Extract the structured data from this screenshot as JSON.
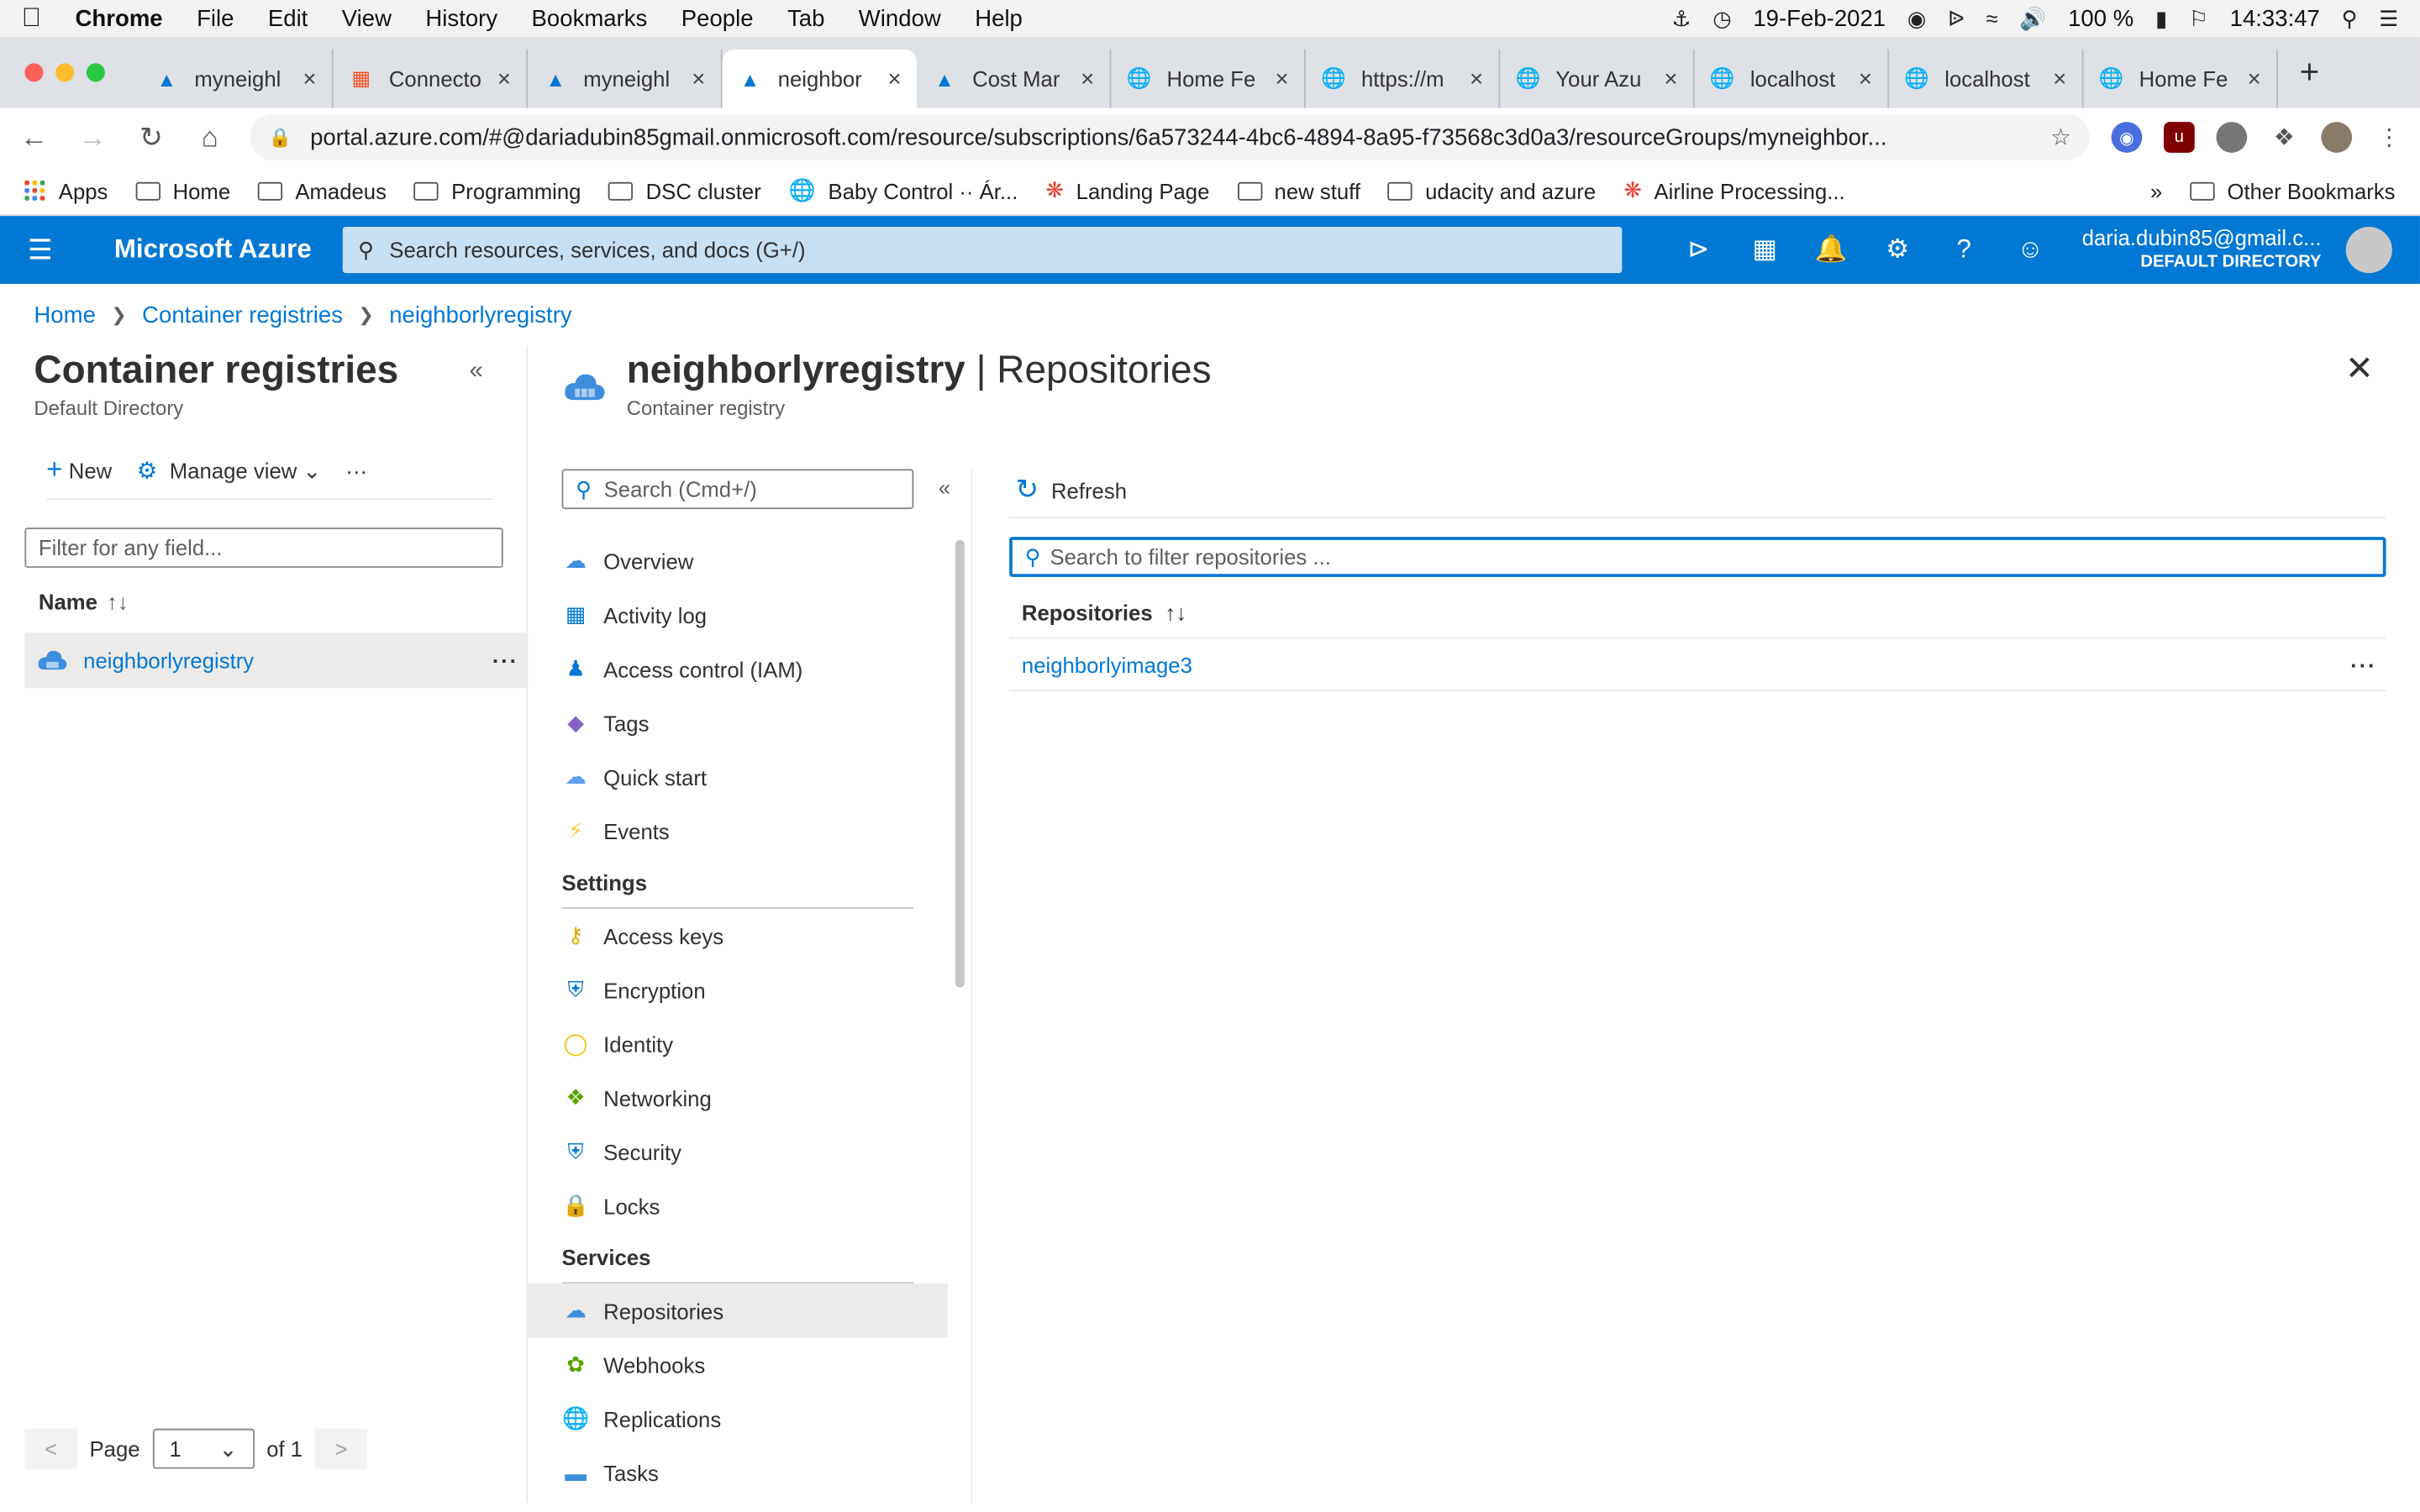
{
  "macos": {
    "app_name": "Chrome",
    "menus": [
      "File",
      "Edit",
      "View",
      "History",
      "Bookmarks",
      "People",
      "Tab",
      "Window",
      "Help"
    ],
    "date": "19-Feb-2021",
    "battery": "100 %",
    "time": "14:33:47"
  },
  "browser": {
    "tabs": [
      {
        "label": "myneighl",
        "icon": "azure-icon",
        "active": false
      },
      {
        "label": "Connecto",
        "icon": "microsoft-icon",
        "active": false
      },
      {
        "label": "myneighl",
        "icon": "azure-icon",
        "active": false
      },
      {
        "label": "neighbor",
        "icon": "azure-icon",
        "active": true
      },
      {
        "label": "Cost Mar",
        "icon": "azure-icon",
        "active": false
      },
      {
        "label": "Home Fe",
        "icon": "globe-icon",
        "active": false
      },
      {
        "label": "https://m",
        "icon": "globe-icon",
        "active": false
      },
      {
        "label": "Your Azu",
        "icon": "globe-icon",
        "active": false
      },
      {
        "label": "localhost",
        "icon": "globe-icon",
        "active": false
      },
      {
        "label": "localhost",
        "icon": "globe-icon",
        "active": false
      },
      {
        "label": "Home Fe",
        "icon": "globe-icon",
        "active": false
      }
    ],
    "url": "portal.azure.com/#@dariadubin85gmail.onmicrosoft.com/resource/subscriptions/6a573244-4bc6-4894-8a95-f73568c3d0a3/resourceGroups/myneighbor...",
    "bookmarks": [
      {
        "label": "Apps",
        "type": "apps"
      },
      {
        "label": "Home",
        "type": "folder"
      },
      {
        "label": "Amadeus",
        "type": "folder"
      },
      {
        "label": "Programming",
        "type": "folder"
      },
      {
        "label": "DSC cluster",
        "type": "folder"
      },
      {
        "label": "Baby Control ·· Ár...",
        "type": "globe"
      },
      {
        "label": "Landing Page",
        "type": "spark"
      },
      {
        "label": "new stuff",
        "type": "folder"
      },
      {
        "label": "udacity and azure",
        "type": "folder"
      },
      {
        "label": "Airline Processing...",
        "type": "spark"
      }
    ],
    "overflow": "»",
    "other_bookmarks": "Other Bookmarks"
  },
  "azure": {
    "brand": "Microsoft Azure",
    "search_placeholder": "Search resources, services, and docs (G+/)",
    "user_email": "daria.dubin85@gmail.c...",
    "user_directory": "DEFAULT DIRECTORY"
  },
  "breadcrumb": [
    "Home",
    "Container registries",
    "neighborlyregistry"
  ],
  "left_pane": {
    "title": "Container registries",
    "subtitle": "Default Directory",
    "new_label": "New",
    "manage_view_label": "Manage view",
    "filter_placeholder": "Filter for any field...",
    "column_name": "Name",
    "rows": [
      "neighborlyregistry"
    ],
    "page_label": "Page",
    "page_value": "1",
    "page_of": "of 1"
  },
  "blade": {
    "resource_name": "neighborlyregistry",
    "section": "Repositories",
    "subtitle": "Container registry",
    "menu_search_placeholder": "Search (Cmd+/)",
    "menu_top": [
      {
        "label": "Overview",
        "icon": "cloud-icon"
      },
      {
        "label": "Activity log",
        "icon": "log-icon"
      },
      {
        "label": "Access control (IAM)",
        "icon": "people-icon"
      },
      {
        "label": "Tags",
        "icon": "tag-icon"
      },
      {
        "label": "Quick start",
        "icon": "quickstart-icon"
      },
      {
        "label": "Events",
        "icon": "lightning-icon"
      }
    ],
    "settings_heading": "Settings",
    "menu_settings": [
      {
        "label": "Access keys",
        "icon": "key-icon"
      },
      {
        "label": "Encryption",
        "icon": "shield-icon"
      },
      {
        "label": "Identity",
        "icon": "identity-icon"
      },
      {
        "label": "Networking",
        "icon": "network-icon"
      },
      {
        "label": "Security",
        "icon": "security-icon"
      },
      {
        "label": "Locks",
        "icon": "lock-icon"
      }
    ],
    "services_heading": "Services",
    "menu_services": [
      {
        "label": "Repositories",
        "icon": "repository-icon"
      },
      {
        "label": "Webhooks",
        "icon": "webhook-icon"
      },
      {
        "label": "Replications",
        "icon": "globe-icon"
      },
      {
        "label": "Tasks",
        "icon": "tasks-icon"
      }
    ],
    "refresh_label": "Refresh",
    "filter_placeholder": "Search to filter repositories ...",
    "column_repositories": "Repositories",
    "repositories": [
      "neighborlyimage3"
    ]
  },
  "colors": {
    "azure_blue": "#0078d4",
    "search_bg": "#c7e0f4"
  }
}
